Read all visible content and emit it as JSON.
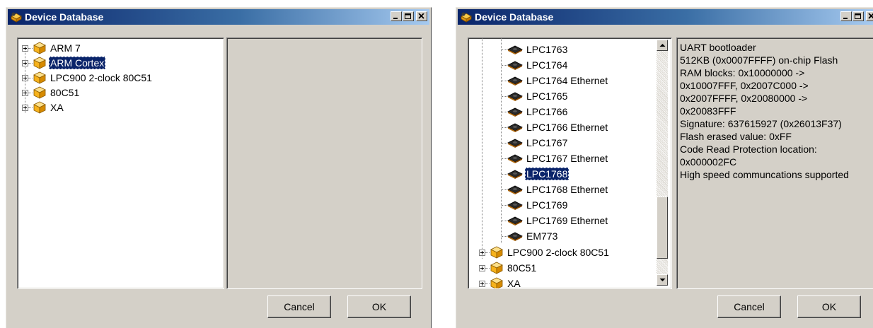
{
  "window1": {
    "title": "Device Database",
    "tree": [
      {
        "label": "ARM 7"
      },
      {
        "label": "ARM Cortex",
        "selected": true
      },
      {
        "label": "LPC900 2-clock 80C51"
      },
      {
        "label": "80C51"
      },
      {
        "label": "XA"
      }
    ],
    "buttons": {
      "cancel": "Cancel",
      "ok": "OK"
    }
  },
  "window2": {
    "title": "Device Database",
    "tree_devices": [
      {
        "label": "LPC1763"
      },
      {
        "label": "LPC1764"
      },
      {
        "label": "LPC1764 Ethernet"
      },
      {
        "label": "LPC1765"
      },
      {
        "label": "LPC1766"
      },
      {
        "label": "LPC1766 Ethernet"
      },
      {
        "label": "LPC1767"
      },
      {
        "label": "LPC1767 Ethernet"
      },
      {
        "label": "LPC1768",
        "selected": true
      },
      {
        "label": "LPC1768 Ethernet"
      },
      {
        "label": "LPC1769"
      },
      {
        "label": "LPC1769 Ethernet"
      },
      {
        "label": "EM773"
      }
    ],
    "tree_families": [
      {
        "label": "LPC900 2-clock 80C51"
      },
      {
        "label": "80C51"
      },
      {
        "label": "XA"
      }
    ],
    "info_lines": [
      "UART bootloader",
      "512KB (0x0007FFFF) on-chip Flash",
      "RAM blocks: 0x10000000 ->",
      "0x10007FFF, 0x2007C000 ->",
      "0x2007FFFF, 0x20080000 ->",
      "0x20083FFF",
      "Signature: 637615927 (0x26013F37)",
      "Flash erased value: 0xFF",
      "Code Read Protection location:",
      "0x000002FC",
      "High speed communcations supported"
    ],
    "buttons": {
      "cancel": "Cancel",
      "ok": "OK"
    }
  }
}
